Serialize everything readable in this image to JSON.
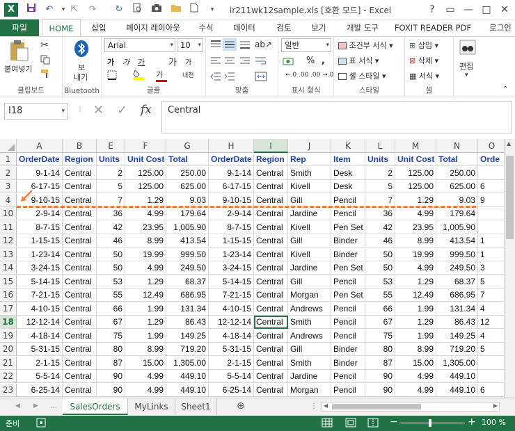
{
  "window": {
    "title": "ir211wk12sample.xls  [호환 모드] - Excel",
    "app_icon": "X",
    "controls": {
      "help": "?",
      "restore": "▭",
      "minimize": "—",
      "maximize": "□",
      "close": "✕"
    }
  },
  "quick_access": [
    "save-icon",
    "undo-icon",
    "redo-icon",
    "refresh-icon",
    "preview-icon",
    "camera-icon",
    "folder-icon",
    "new-icon",
    "more-icon"
  ],
  "ribbon_tabs": {
    "file": "파일",
    "items": [
      "HOME",
      "삽입",
      "페이지 레이아웃",
      "수식",
      "데이터",
      "검토",
      "보기",
      "개발 도구",
      "FOXIT READER PDF"
    ],
    "account": "로그인"
  },
  "ribbon": {
    "clipboard": {
      "paste": "붙여넣기",
      "label": "클립보드"
    },
    "bluetooth": {
      "send_line1": "보",
      "send_line2": "내기",
      "label": "Bluetooth"
    },
    "font": {
      "name": "Arial",
      "size": "10",
      "bold": "가",
      "italic": "가",
      "underline": "가",
      "grow": "가",
      "shrink": "가",
      "font_color": "가",
      "phonetic": "내천",
      "label": "글꼴"
    },
    "alignment": {
      "label": "맞춤"
    },
    "number": {
      "format": "일반",
      "percent": "%",
      "comma": ",",
      "label": "표시 형식"
    },
    "styles": {
      "conditional": "조건부 서식",
      "table": "표 서식",
      "cell": "셀 스타일",
      "label": "스타일"
    },
    "cells": {
      "insert": "삽입",
      "delete": "삭제",
      "format": "서식",
      "label": "셀"
    },
    "editing": {
      "edit": "편집"
    }
  },
  "formula_bar": {
    "name_box": "I18",
    "cancel": "✕",
    "enter": "✓",
    "fx": "fx",
    "value": "Central"
  },
  "columns": [
    "A",
    "B",
    "E",
    "F",
    "G",
    "H",
    "I",
    "J",
    "K",
    "L",
    "M",
    "N",
    "O"
  ],
  "header_row": [
    "OrderDate",
    "Region",
    "Units",
    "Unit Cost",
    "Total",
    "OrderDate",
    "Region",
    "Rep",
    "Item",
    "Units",
    "Unit Cost",
    "Total",
    "Orde"
  ],
  "rows": [
    {
      "n": "2",
      "c": [
        "9-1-14",
        "Central",
        "2",
        "125.00",
        "250.00",
        "9-1-14",
        "Central",
        "Smith",
        "Desk",
        "2",
        "125.00",
        "250.00",
        ""
      ]
    },
    {
      "n": "3",
      "c": [
        "6-17-15",
        "Central",
        "5",
        "125.00",
        "625.00",
        "6-17-15",
        "Central",
        "Kivell",
        "Desk",
        "5",
        "125.00",
        "625.00",
        "6"
      ]
    },
    {
      "n": "4",
      "c": [
        "9-10-15",
        "Central",
        "7",
        "1.29",
        "9.03",
        "9-10-15",
        "Central",
        "Gill",
        "Pencil",
        "7",
        "1.29",
        "9.03",
        "9"
      ]
    },
    {
      "n": "10",
      "c": [
        "2-9-14",
        "Central",
        "36",
        "4.99",
        "179.64",
        "2-9-14",
        "Central",
        "Jardine",
        "Pencil",
        "36",
        "4.99",
        "179.64",
        ""
      ]
    },
    {
      "n": "11",
      "c": [
        "8-7-15",
        "Central",
        "42",
        "23.95",
        "1,005.90",
        "8-7-15",
        "Central",
        "Kivell",
        "Pen Set",
        "42",
        "23.95",
        "1,005.90",
        ""
      ]
    },
    {
      "n": "12",
      "c": [
        "1-15-15",
        "Central",
        "46",
        "8.99",
        "413.54",
        "1-15-15",
        "Central",
        "Gill",
        "Binder",
        "46",
        "8.99",
        "413.54",
        "1"
      ]
    },
    {
      "n": "13",
      "c": [
        "1-23-14",
        "Central",
        "50",
        "19.99",
        "999.50",
        "1-23-14",
        "Central",
        "Kivell",
        "Binder",
        "50",
        "19.99",
        "999.50",
        "1"
      ]
    },
    {
      "n": "14",
      "c": [
        "3-24-15",
        "Central",
        "50",
        "4.99",
        "249.50",
        "3-24-15",
        "Central",
        "Jardine",
        "Pen Set",
        "50",
        "4.99",
        "249.50",
        "3"
      ]
    },
    {
      "n": "15",
      "c": [
        "5-14-15",
        "Central",
        "53",
        "1.29",
        "68.37",
        "5-14-15",
        "Central",
        "Gill",
        "Pencil",
        "53",
        "1.29",
        "68.37",
        "5"
      ]
    },
    {
      "n": "16",
      "c": [
        "7-21-15",
        "Central",
        "55",
        "12.49",
        "686.95",
        "7-21-15",
        "Central",
        "Morgan",
        "Pen Set",
        "55",
        "12.49",
        "686.95",
        "7"
      ]
    },
    {
      "n": "17",
      "c": [
        "4-10-15",
        "Central",
        "66",
        "1.99",
        "131.34",
        "4-10-15",
        "Central",
        "Andrews",
        "Pencil",
        "66",
        "1.99",
        "131.34",
        "4"
      ]
    },
    {
      "n": "18",
      "c": [
        "12-12-14",
        "Central",
        "67",
        "1.29",
        "86.43",
        "12-12-14",
        "Central",
        "Smith",
        "Pencil",
        "67",
        "1.29",
        "86.43",
        "12"
      ]
    },
    {
      "n": "19",
      "c": [
        "4-18-14",
        "Central",
        "75",
        "1.99",
        "149.25",
        "4-18-14",
        "Central",
        "Andrews",
        "Pencil",
        "75",
        "1.99",
        "149.25",
        "4"
      ]
    },
    {
      "n": "20",
      "c": [
        "5-31-15",
        "Central",
        "80",
        "8.99",
        "719.20",
        "5-31-15",
        "Central",
        "Gill",
        "Binder",
        "80",
        "8.99",
        "719.20",
        "5"
      ]
    },
    {
      "n": "21",
      "c": [
        "2-1-15",
        "Central",
        "87",
        "15.00",
        "1,305.00",
        "2-1-15",
        "Central",
        "Smith",
        "Binder",
        "87",
        "15.00",
        "1,305.00",
        ""
      ]
    },
    {
      "n": "22",
      "c": [
        "5-5-14",
        "Central",
        "90",
        "4.99",
        "449.10",
        "5-5-14",
        "Central",
        "Jardine",
        "Pencil",
        "90",
        "4.99",
        "449.10",
        ""
      ]
    },
    {
      "n": "23",
      "c": [
        "6-25-14",
        "Central",
        "90",
        "4.99",
        "449.10",
        "6-25-14",
        "Central",
        "Morgan",
        "Pencil",
        "90",
        "4.99",
        "449.10",
        "6"
      ]
    }
  ],
  "sheet_tabs": [
    "SalesOrders",
    "MyLinks",
    "Sheet1"
  ],
  "status": {
    "ready": "준비",
    "zoom": "100 %",
    "zoom_out": "−",
    "zoom_in": "+"
  },
  "colors": {
    "excel_green": "#217346",
    "header_blue": "#1f3fbf",
    "freeze_line": "#ff7a2e"
  }
}
